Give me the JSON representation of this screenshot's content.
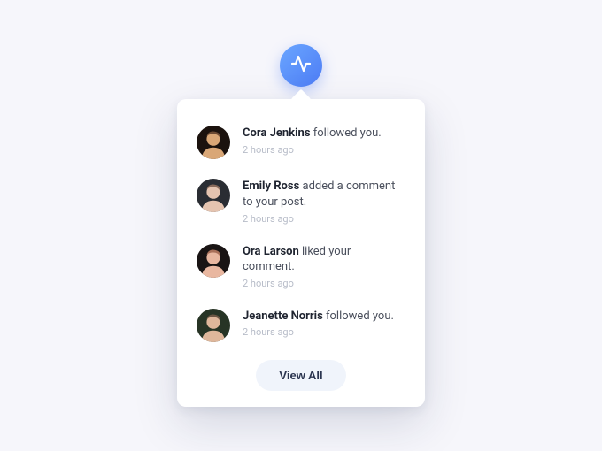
{
  "trigger": {
    "icon_name": "activity-icon"
  },
  "notifications": [
    {
      "name": "Cora Jenkins",
      "action": "followed you.",
      "time": "2 hours ago"
    },
    {
      "name": "Emily Ross",
      "action": "added a comment to your post.",
      "time": "2 hours ago"
    },
    {
      "name": "Ora Larson",
      "action": "liked your comment.",
      "time": "2 hours ago"
    },
    {
      "name": "Jeanette Norris",
      "action": "followed you.",
      "time": "2 hours ago"
    }
  ],
  "footer": {
    "view_all_label": "View All"
  },
  "avatar_palettes": [
    [
      "#1b120e",
      "#d9a777",
      "#6b4a34"
    ],
    [
      "#2a2d33",
      "#e5c4b0",
      "#8a6b5b"
    ],
    [
      "#191414",
      "#e9b7a0",
      "#a9705a"
    ],
    [
      "#273425",
      "#dfb79b",
      "#6d5744"
    ]
  ]
}
